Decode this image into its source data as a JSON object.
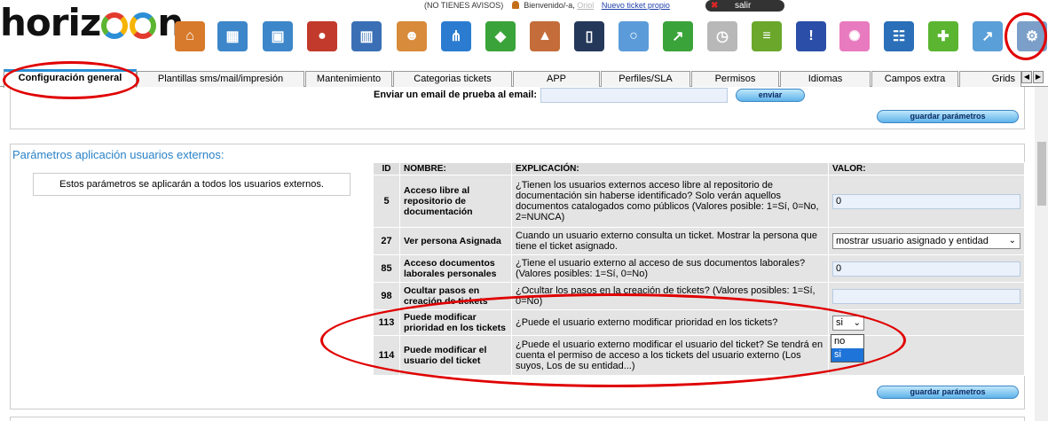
{
  "header": {
    "logo_text": "horizoon",
    "notice": "(NO TIENES AVISOS)",
    "welcome": "Bienvenido/-a,",
    "user": "Oriol",
    "new_ticket": "Nuevo ticket propio",
    "logout": "salir"
  },
  "toolbar_icons": [
    {
      "name": "home-icon",
      "color": "#d77a2b",
      "glyph": "⌂"
    },
    {
      "name": "image-search-icon",
      "color": "#3d86c9",
      "glyph": "▦"
    },
    {
      "name": "screen-search-icon",
      "color": "#3d86c9",
      "glyph": "▣"
    },
    {
      "name": "map-pin-icon",
      "color": "#c23a2b",
      "glyph": "●"
    },
    {
      "name": "building-icon",
      "color": "#3a6fb5",
      "glyph": "▥"
    },
    {
      "name": "users-icon",
      "color": "#d88b3a",
      "glyph": "☻"
    },
    {
      "name": "hierarchy-icon",
      "color": "#2b7cd1",
      "glyph": "⋔"
    },
    {
      "name": "cubes-icon",
      "color": "#3aa339",
      "glyph": "◆"
    },
    {
      "name": "factory-icon",
      "color": "#c46d3a",
      "glyph": "▲"
    },
    {
      "name": "tablet-icon",
      "color": "#24385a",
      "glyph": "▯"
    },
    {
      "name": "magnifier-icon",
      "color": "#5b9bd9",
      "glyph": "○"
    },
    {
      "name": "chart-icon",
      "color": "#3aa339",
      "glyph": "↗"
    },
    {
      "name": "stopwatch-icon",
      "color": "#b8b8b8",
      "glyph": "◷"
    },
    {
      "name": "books-icon",
      "color": "#6aa72b",
      "glyph": "≡"
    },
    {
      "name": "warning-icon",
      "color": "#2b4fa8",
      "glyph": "!"
    },
    {
      "name": "dots-circle-icon",
      "color": "#e87bbf",
      "glyph": "✺"
    },
    {
      "name": "team-icon",
      "color": "#2a6fb8",
      "glyph": "☷"
    },
    {
      "name": "puzzle-icon",
      "color": "#5bb531",
      "glyph": "✚"
    },
    {
      "name": "growth-chart-icon",
      "color": "#5a9fd8",
      "glyph": "↗"
    },
    {
      "name": "settings-gears-icon",
      "color": "#7b9fc8",
      "glyph": "⚙"
    }
  ],
  "tabs": [
    "Configuración general",
    "Plantillas sms/mail/impresión",
    "Mantenimiento",
    "Categorias tickets",
    "APP",
    "Perfiles/SLA",
    "Permisos",
    "Idiomas",
    "Campos extra",
    "Grids"
  ],
  "email_test": {
    "label": "Enviar un email de prueba al email:",
    "value": "",
    "send_button": "enviar"
  },
  "save_button": "guardar parámetros",
  "external_users": {
    "title": "Parámetros aplicación usuarios externos:",
    "info": "Estos parámetros se aplicarán a todos los usuarios externos.",
    "columns": [
      "ID",
      "NOMBRE:",
      "EXPLICACIÓN:",
      "VALOR:"
    ],
    "rows": [
      {
        "id": "5",
        "name": "Acceso libre al repositorio de documentación",
        "explanation": "¿Tienen los usuarios externos acceso libre al repositorio de documentación sin haberse identificado? Solo verán aquellos documentos catalogados como públicos (Valores posible: 1=Sí, 0=No, 2=NUNCA)",
        "value": "0"
      },
      {
        "id": "27",
        "name": "Ver persona Asignada",
        "explanation": "Cuando un usuario externo consulta un ticket. Mostrar la persona que tiene el ticket asignado.",
        "value": "mostrar usuario asignado y entidad"
      },
      {
        "id": "85",
        "name": "Acceso documentos laborales personales",
        "explanation": "¿Tiene el usuario externo al acceso de sus documentos laborales? (Valores posibles: 1=Sí, 0=No)",
        "value": "0"
      },
      {
        "id": "98",
        "name": "Ocultar pasos en creación de tickets",
        "explanation": "¿Ocultar los pasos en la creación de tickets? (Valores posibles: 1=Sí, 0=No)",
        "value": ""
      },
      {
        "id": "113",
        "name": "Puede modificar prioridad en los tickets",
        "explanation": "¿Puede el usuario externo modificar prioridad en los tickets?",
        "value": "si"
      },
      {
        "id": "114",
        "name": "Puede modificar el usuario del ticket",
        "explanation": "¿Puede el usuario externo modificar el usuario del ticket? Se tendrá en cuenta el permiso de acceso a los tickets del usuario externo (Los suyos, Los de su entidad...)",
        "value": ""
      }
    ],
    "dropdown_options": [
      "no",
      "si"
    ],
    "dropdown_selected": "si"
  },
  "colors": {
    "accent": "#2a82c8",
    "annotation": "#e00000",
    "button": "#5fb3ea"
  }
}
